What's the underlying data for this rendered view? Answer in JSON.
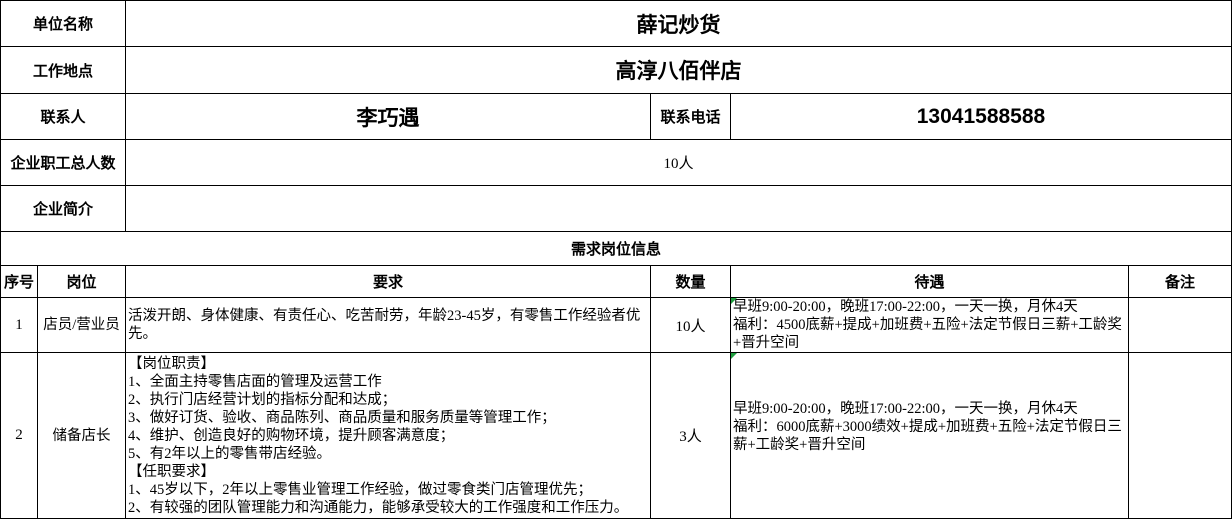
{
  "company": {
    "name_label": "单位名称",
    "name": "薛记炒货",
    "location_label": "工作地点",
    "location": "高淳八佰伴店",
    "contact_label": "联系人",
    "contact_name": "李巧遇",
    "phone_label": "联系电话",
    "phone": "13041588588",
    "staff_count_label": "企业职工总人数",
    "staff_count": "10人",
    "intro_label": "企业简介"
  },
  "positions": {
    "section_title": "需求岗位信息",
    "headers": {
      "no": "序号",
      "position": "岗位",
      "requirements": "要求",
      "quantity": "数量",
      "benefits": "待遇",
      "notes": "备注"
    },
    "rows": [
      {
        "no": "1",
        "position": "店员/营业员",
        "requirements": "活泼开朗、身体健康、有责任心、吃苦耐劳，年龄23-45岁，有零售工作经验者优先。",
        "quantity": "10人",
        "benefits": "早班9:00-20:00，晚班17:00-22:00，一天一换，月休4天\n福利：4500底薪+提成+加班费+五险+法定节假日三薪+工龄奖+晋升空间"
      },
      {
        "no": "2",
        "position": "储备店长",
        "requirements": "【岗位职责】\n1、全面主持零售店面的管理及运营工作\n2、执行门店经营计划的指标分配和达成；\n3、做好订货、验收、商品陈列、商品质量和服务质量等管理工作；\n4、维护、创造良好的购物环境，提升顾客满意度；\n5、有2年以上的零售带店经验。\n【任职要求】\n1、45岁以下，2年以上零售业管理工作经验，做过零食类门店管理优先；\n2、有较强的团队管理能力和沟通能力，能够承受较大的工作强度和工作压力。",
        "quantity": "3人",
        "benefits": "早班9:00-20:00，晚班17:00-22:00，一天一换，月休4天\n福利：6000底薪+3000绩效+提成+加班费+五险+法定节假日三薪+工龄奖+晋升空间"
      }
    ]
  },
  "colors": {
    "grid_line": "#000000",
    "cell_indicator": "#1e9e3e",
    "background": "#ffffff",
    "text": "#000000"
  }
}
